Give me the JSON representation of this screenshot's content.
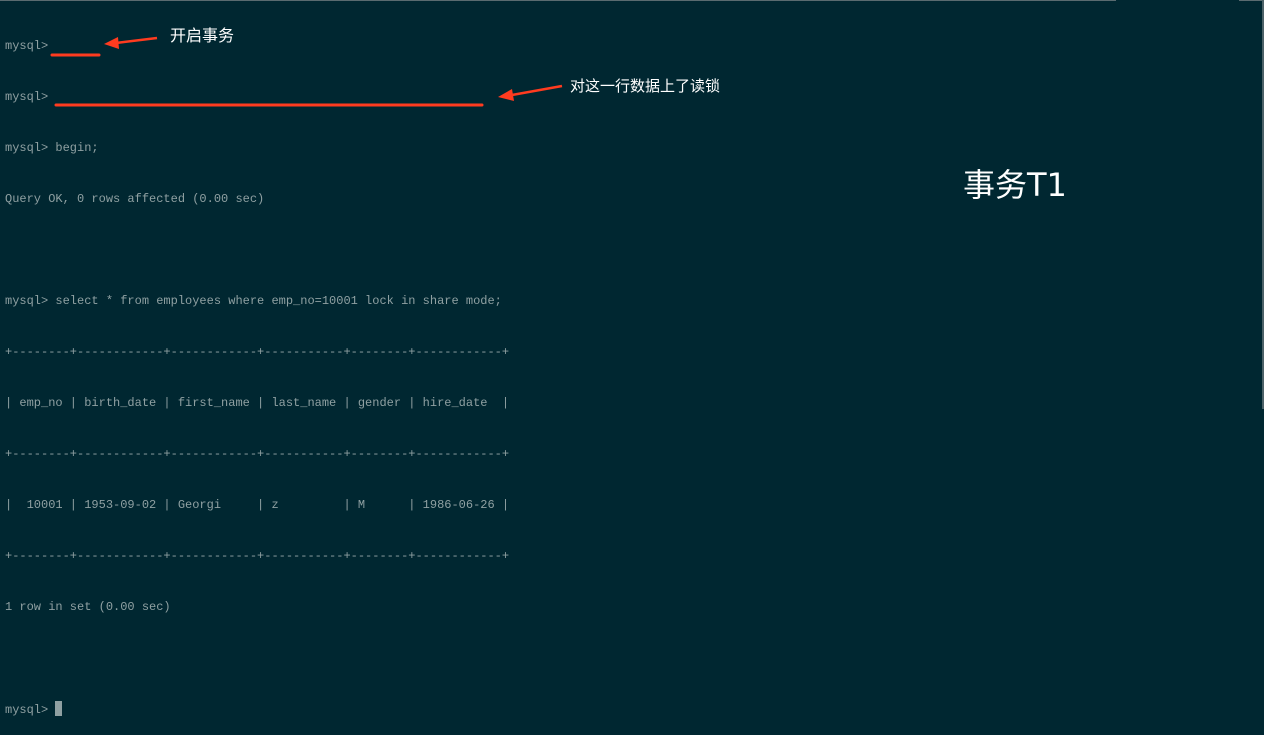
{
  "terminal": {
    "lines": [
      "mysql>",
      "mysql>",
      "mysql> begin;",
      "Query OK, 0 rows affected (0.00 sec)",
      "",
      "mysql> select * from employees where emp_no=10001 lock in share mode;",
      "+--------+------------+------------+-----------+--------+------------+",
      "| emp_no | birth_date | first_name | last_name | gender | hire_date  |",
      "+--------+------------+------------+-----------+--------+------------+",
      "|  10001 | 1953-09-02 | Georgi     | z         | M      | 1986-06-26 |",
      "+--------+------------+------------+-----------+--------+------------+",
      "1 row in set (0.00 sec)",
      ""
    ],
    "prompt": "mysql> "
  },
  "annotations": {
    "begin_note": "开启事务",
    "lock_note": "对这一行数据上了读锁",
    "title": "事务T1"
  },
  "colors": {
    "background": "#002731",
    "text": "#8fa0a2",
    "annotation": "#ff3b1f"
  }
}
